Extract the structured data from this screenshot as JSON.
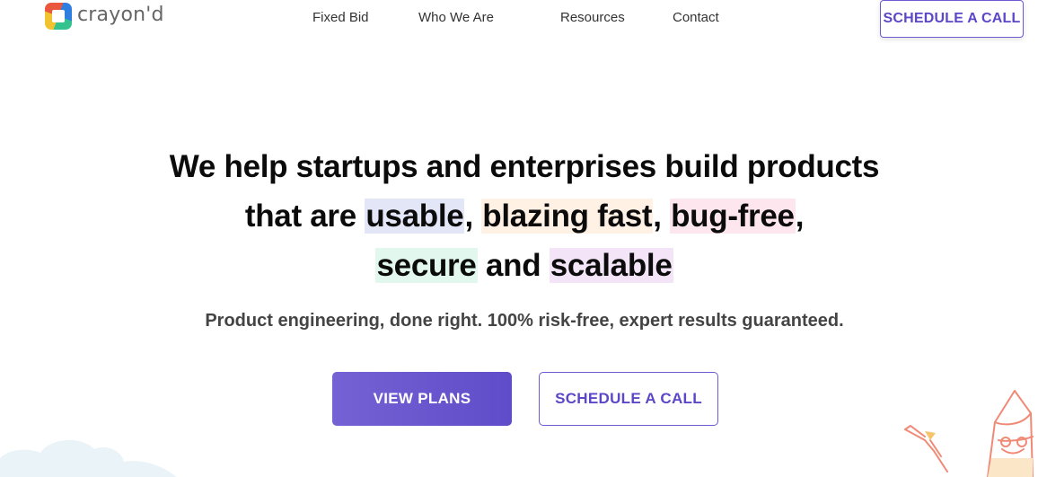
{
  "header": {
    "logo_text": "crayon'd",
    "nav": [
      {
        "label": "Fixed Bid"
      },
      {
        "label": "Who We Are"
      },
      {
        "label": "Resources"
      },
      {
        "label": "Contact"
      }
    ],
    "cta_label": "SCHEDULE A CALL"
  },
  "hero": {
    "line1": "We help startups and enterprises build products",
    "line2_prefix": "that are ",
    "usable": "usable",
    "comma1": ", ",
    "blazing": "blazing fast",
    "comma2": ", ",
    "bugfree": "bug-free",
    "comma3": ",",
    "secure": "secure",
    "and": " and ",
    "scalable": "scalable",
    "subtitle": "Product engineering, done right. 100% risk-free, expert results guaranteed.",
    "primary_button": "VIEW PLANS",
    "secondary_button": "SCHEDULE A CALL"
  },
  "colors": {
    "brand_purple": "#5f4cc9",
    "highlight_blue": "#e3e6f7",
    "highlight_orange": "#fff1e3",
    "highlight_pink": "#fde6ee",
    "highlight_green": "#e2f7ee",
    "highlight_purple": "#f3e4f7"
  },
  "icons": {
    "logo": "crayond-logo-icon",
    "mascot": "crayon-mascot-illustration",
    "cloud": "cloud-illustration"
  }
}
